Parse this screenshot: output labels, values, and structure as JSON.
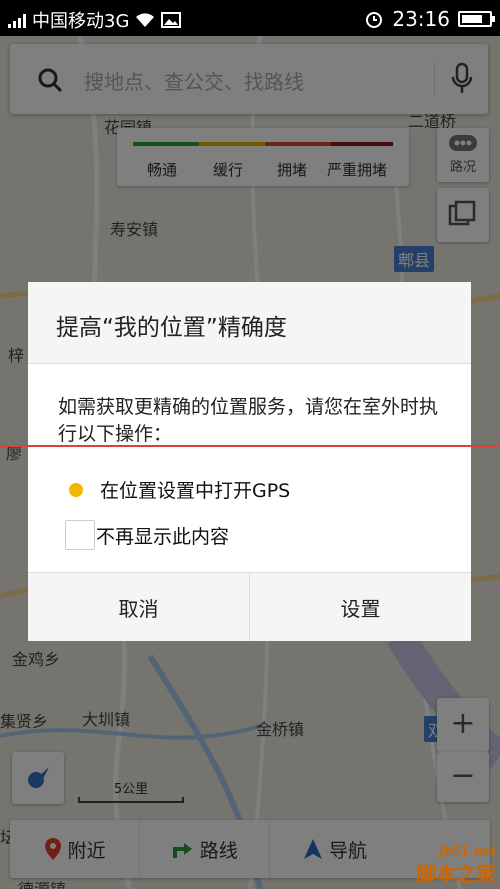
{
  "status_bar": {
    "carrier": "中国移动3G",
    "time": "23:16"
  },
  "search": {
    "placeholder": "搜地点、查公交、找路线"
  },
  "traffic_legend": {
    "items": [
      {
        "label": "畅通",
        "color": "#2aa52a"
      },
      {
        "label": "缓行",
        "color": "#e6b800"
      },
      {
        "label": "拥堵",
        "color": "#d94a2b"
      },
      {
        "label": "严重拥堵",
        "color": "#8b1a1a"
      }
    ]
  },
  "map": {
    "side_buttons": {
      "traffic": "路况"
    },
    "labels": [
      "花园镇",
      "寿安镇",
      "梓",
      "廖",
      "金鸡乡",
      "集贤乡",
      "大圳镇",
      "金桥镇",
      "坛",
      "德源镇",
      "二道桥"
    ],
    "county_badge": "郫县",
    "partial_badge": "双",
    "scale": "5公里",
    "zoom_in": "+",
    "zoom_out": "−"
  },
  "bottom_nav": {
    "nearby": "附近",
    "route": "路线",
    "navigate": "导航"
  },
  "dialog": {
    "title": "提高“我的位置”精确度",
    "message": "如需获取更精确的位置服务，请您在室外时执行以下操作：",
    "option_gps": "在位置设置中打开GPS",
    "checkbox_label": "不再显示此内容",
    "cancel": "取消",
    "settings": "设置"
  },
  "watermark": {
    "site": "jb51.net",
    "name": "脚本之家"
  },
  "colors": {
    "accent": "#4a7fd6",
    "gps_dot": "#f2b700",
    "redline": "#e0403a"
  }
}
